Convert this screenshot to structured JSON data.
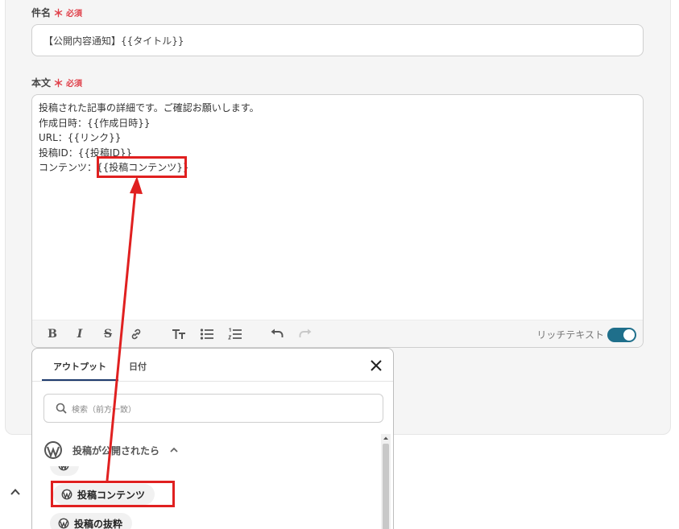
{
  "subject_field": {
    "label": "件名",
    "required_mark": "＊",
    "required_text": "必須",
    "value": "【公開内容通知】{{タイトル}}"
  },
  "body_field": {
    "label": "本文",
    "required_mark": "＊",
    "required_text": "必須",
    "lines": [
      "投稿された記事の詳細です。ご確認お願いします。",
      "作成日時：{{作成日時}}",
      "URL：{{リンク}}",
      "投稿ID：{{投稿ID}}"
    ],
    "last_line_prefix": "コンテンツ：",
    "last_line_token": "{{投稿コンテンツ}}",
    "toolbar": {
      "icons": [
        "bold-icon",
        "italic-icon",
        "strikethrough-icon",
        "link-icon",
        "text-size-icon",
        "bullet-list-icon",
        "numbered-list-icon",
        "undo-icon",
        "redo-icon"
      ],
      "rich_text_label": "リッチテキスト",
      "rich_text_enabled": true,
      "toggle_color": "#1f6f8b"
    }
  },
  "output_panel": {
    "tabs": [
      "アウトプット",
      "日付"
    ],
    "active_tab": "アウトプット",
    "search_placeholder": "検索（前方一致）",
    "group_title": "投稿が公開されたら",
    "items": [
      "投稿コンテンツ",
      "投稿の抜粋"
    ]
  },
  "colors": {
    "highlight": "#e02020",
    "required": "#e0404a",
    "tab_underline": "#1f3c6e"
  }
}
